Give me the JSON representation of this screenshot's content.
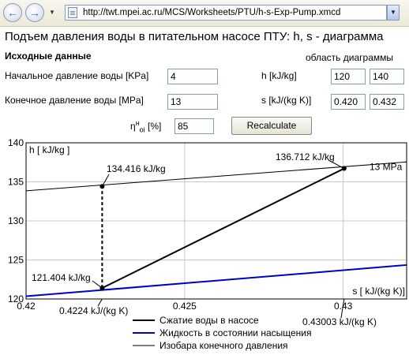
{
  "browser": {
    "url": "http://twt.mpei.ac.ru/MCS/Worksheets/PTU/h-s-Exp-Pump.xmcd"
  },
  "page": {
    "title": "Подъем давления воды в питательном насосе ПТУ: h, s - диаграмма",
    "input_header": "Исходные данные",
    "area_header": "область диаграммы",
    "p_start_label": "Начальное давление воды [KPa]",
    "p_start_value": "4",
    "p_end_label": "Конечное давление воды [MPa]",
    "p_end_value": "13",
    "h_label": "h [kJ/kg]",
    "h_min": "120",
    "h_max": "140",
    "s_label": "s [kJ/(kg K)]",
    "s_min": "0.420",
    "s_max": "0.432",
    "eta_label": "η",
    "eta_sup": "н",
    "eta_sub": "oi",
    "eta_unit": " [%]",
    "eta_value": "85",
    "recalc_label": "Recalculate"
  },
  "chart_data": {
    "type": "line",
    "xlim": [
      0.42,
      0.432
    ],
    "ylim": [
      120,
      140
    ],
    "x_ticks": [
      "0.42",
      "0.425",
      "0.43"
    ],
    "y_ticks": [
      "120",
      "125",
      "130",
      "135",
      "140"
    ],
    "ylabel": "h [ kJ/kg ]",
    "xlabel": "s [ kJ/(kg K)]",
    "series": [
      {
        "name": "Сжатие воды в насосе",
        "color": "#000000",
        "width": 2,
        "points": [
          [
            0.4224,
            121.404
          ],
          [
            0.43003,
            136.712
          ]
        ]
      },
      {
        "name": "Жидкость в состоянии насыщения",
        "color": "#0000cc",
        "width": 2,
        "points": [
          [
            0.42,
            120.35
          ],
          [
            0.432,
            124.35
          ]
        ]
      },
      {
        "name": "Изобара конечного давления",
        "color": "#000000",
        "width": 1,
        "points": [
          [
            0.42,
            133.85
          ],
          [
            0.432,
            137.55
          ]
        ]
      }
    ],
    "isobar_label": "13 MPa",
    "dashed_vertical": {
      "x": 0.4224,
      "y_from": 121.404,
      "y_to": 134.416
    },
    "points": [
      {
        "x": 0.4224,
        "y": 121.404,
        "label": "121.404 kJ/kg"
      },
      {
        "x": 0.4224,
        "y": 134.416,
        "label": "134.416 kJ/kg"
      },
      {
        "x": 0.43003,
        "y": 136.712,
        "label": "136.712 kJ/kg"
      }
    ],
    "x_marker_labels": [
      "0.4224 kJ/(kg K)",
      "0.43003 kJ/(kg K)"
    ]
  }
}
